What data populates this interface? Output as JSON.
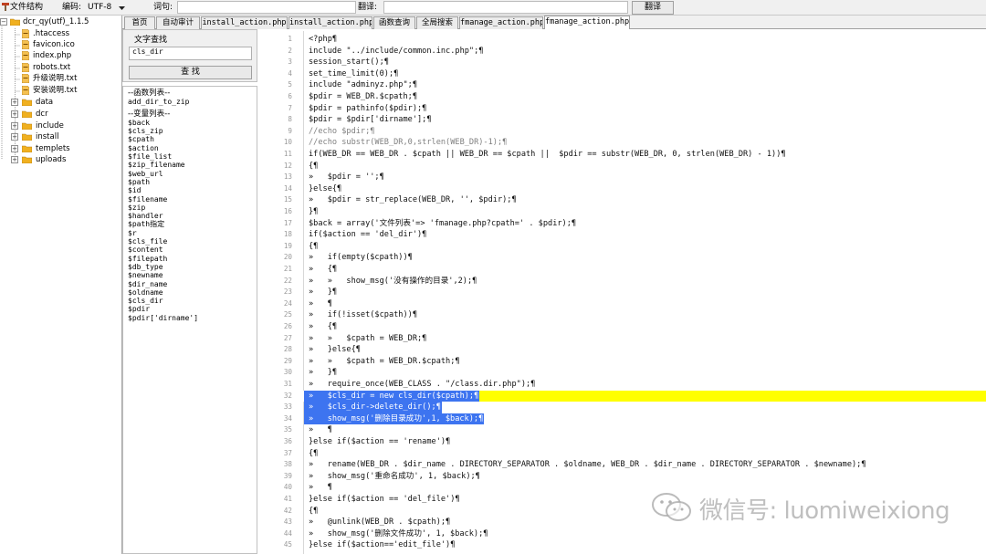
{
  "colors": {
    "highlight": "#ffff00",
    "selection": "#3d74f0",
    "folder": "#f0b020",
    "string": "#0000cc",
    "keyword": "#000080",
    "comment": "#808080"
  },
  "toolbar": {
    "structure_label": "文件结构",
    "encoding_label": "编码:",
    "encoding_value": "UTF-8",
    "word_label": "词句:",
    "word_value": "",
    "translate_label": "翻译:",
    "translate_value": "",
    "translate_button": "翻译"
  },
  "file_tree": {
    "root": "dcr_qy(utf)_1.1.5",
    "items": [
      {
        "label": ".htaccess",
        "kind": "file"
      },
      {
        "label": "favicon.ico",
        "kind": "file"
      },
      {
        "label": "index.php",
        "kind": "file"
      },
      {
        "label": "robots.txt",
        "kind": "file"
      },
      {
        "label": "升级说明.txt",
        "kind": "file"
      },
      {
        "label": "安装说明.txt",
        "kind": "file"
      },
      {
        "label": "data",
        "kind": "folder"
      },
      {
        "label": "dcr",
        "kind": "folder"
      },
      {
        "label": "include",
        "kind": "folder"
      },
      {
        "label": "install",
        "kind": "folder"
      },
      {
        "label": "templets",
        "kind": "folder"
      },
      {
        "label": "uploads",
        "kind": "folder"
      }
    ]
  },
  "tabs": [
    {
      "label": "首页",
      "active": false
    },
    {
      "label": "自动审计",
      "active": false
    },
    {
      "label": "install_action.php",
      "active": false
    },
    {
      "label": "install_action.php",
      "active": false
    },
    {
      "label": "函数查询",
      "active": false
    },
    {
      "label": "全局搜索",
      "active": false
    },
    {
      "label": "fmanage_action.php",
      "active": false
    },
    {
      "label": "fmanage_action.php",
      "active": true
    }
  ],
  "search": {
    "legend": "文字查找",
    "input_value": "cls_dir",
    "button": "查 找"
  },
  "symbols": {
    "functions_header": "--函数列表--",
    "functions": [
      "add_dir_to_zip"
    ],
    "variables_header": "--变量列表--",
    "variables": [
      "$back",
      "$cls_zip",
      "$cpath",
      "$action",
      "$file_list",
      "$zip_filename",
      "$web_url",
      "$path",
      "$id",
      "$filename",
      "$zip",
      "$handler",
      "$path指定",
      "$r",
      "$cls_file",
      "$content",
      "$filepath",
      "$db_type",
      "$newname",
      "$dir_name",
      "$oldname",
      "$cls_dir",
      "$pdir",
      "$pdir['dirname']"
    ]
  },
  "code": {
    "lines": [
      {
        "n": "1",
        "text": "<?php¶"
      },
      {
        "n": "2",
        "text": "include \"../include/common.inc.php\";¶"
      },
      {
        "n": "3",
        "text": "session_start();¶"
      },
      {
        "n": "4",
        "text": "set_time_limit(0);¶"
      },
      {
        "n": "5",
        "text": "include \"adminyz.php\";¶"
      },
      {
        "n": "6",
        "text": "$pdir = WEB_DR.$cpath;¶"
      },
      {
        "n": "7",
        "text": "$pdir = pathinfo($pdir);¶"
      },
      {
        "n": "8",
        "text": "$pdir = $pdir['dirname'];¶"
      },
      {
        "n": "9",
        "text": "//echo $pdir;¶"
      },
      {
        "n": "10",
        "text": "//echo substr(WEB_DR,0,strlen(WEB_DR)-1);¶"
      },
      {
        "n": "11",
        "text": "if(WEB_DR == WEB_DR . $cpath || WEB_DR == $cpath ||  $pdir == substr(WEB_DR, 0, strlen(WEB_DR) - 1))¶"
      },
      {
        "n": "12",
        "text": "{¶"
      },
      {
        "n": "13",
        "text": "»   $pdir = '';¶"
      },
      {
        "n": "14",
        "text": "}else{¶"
      },
      {
        "n": "15",
        "text": "»   $pdir = str_replace(WEB_DR, '', $pdir);¶"
      },
      {
        "n": "16",
        "text": "}¶"
      },
      {
        "n": "17",
        "text": "$back = array('文件列表'=> 'fmanage.php?cpath=' . $pdir);¶"
      },
      {
        "n": "18",
        "text": "if($action == 'del_dir')¶"
      },
      {
        "n": "19",
        "text": "{¶"
      },
      {
        "n": "20",
        "text": "»   if(empty($cpath))¶"
      },
      {
        "n": "21",
        "text": "»   {¶"
      },
      {
        "n": "22",
        "text": "»   »   show_msg('没有操作的目录',2);¶"
      },
      {
        "n": "23",
        "text": "»   }¶"
      },
      {
        "n": "24",
        "text": "»   ¶"
      },
      {
        "n": "25",
        "text": "»   if(!isset($cpath))¶"
      },
      {
        "n": "26",
        "text": "»   {¶"
      },
      {
        "n": "27",
        "text": "»   »   $cpath = WEB_DR;¶"
      },
      {
        "n": "28",
        "text": "»   }else{¶"
      },
      {
        "n": "29",
        "text": "»   »   $cpath = WEB_DR.$cpath;¶"
      },
      {
        "n": "30",
        "text": "»   }¶"
      },
      {
        "n": "31",
        "text": "»   require_once(WEB_CLASS . \"/class.dir.php\");¶"
      },
      {
        "n": "32",
        "text": "»   $cls_dir = new cls_dir($cpath);¶",
        "hl": "yellow-sel"
      },
      {
        "n": "33",
        "text": "»   $cls_dir->delete_dir();¶",
        "hl": "sel"
      },
      {
        "n": "34",
        "text": "»   show_msg('删除目录成功',1, $back);¶",
        "hl": "sel"
      },
      {
        "n": "35",
        "text": "»   ¶"
      },
      {
        "n": "36",
        "text": "}else if($action == 'rename')¶"
      },
      {
        "n": "37",
        "text": "{¶"
      },
      {
        "n": "38",
        "text": "»   rename(WEB_DR . $dir_name . DIRECTORY_SEPARATOR . $oldname, WEB_DR . $dir_name . DIRECTORY_SEPARATOR . $newname);¶"
      },
      {
        "n": "39",
        "text": "»   show_msg('重命名成功', 1, $back);¶"
      },
      {
        "n": "40",
        "text": "»   ¶"
      },
      {
        "n": "41",
        "text": "}else if($action == 'del_file')¶"
      },
      {
        "n": "42",
        "text": "{¶"
      },
      {
        "n": "43",
        "text": "»   @unlink(WEB_DR . $cpath);¶"
      },
      {
        "n": "44",
        "text": "»   show_msg('删除文件成功', 1, $back);¶"
      },
      {
        "n": "45",
        "text": "}else if($action=='edit_file')¶"
      }
    ]
  },
  "watermark": {
    "text": "微信号: luomiweixiong"
  }
}
